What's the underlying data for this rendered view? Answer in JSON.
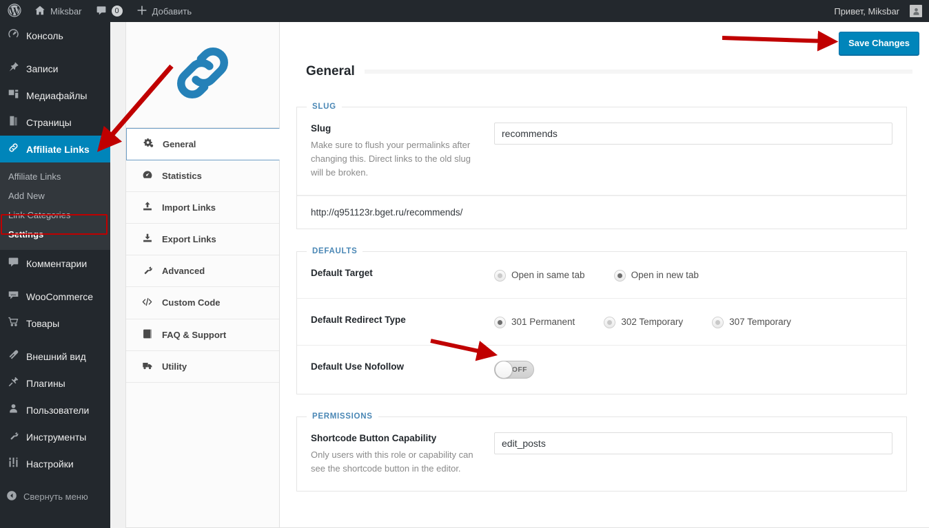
{
  "adminbar": {
    "logo_icon": "wordpress-icon",
    "site_name": "Miksbar",
    "site_icon": "home-icon",
    "comments_icon": "comment-icon",
    "comments_count": "0",
    "new_icon": "plus-icon",
    "new_label": "Добавить",
    "greeting": "Привет, Miksbar",
    "avatar_icon": "user-avatar-icon"
  },
  "adminmenu": {
    "items": [
      {
        "label": "Консоль",
        "icon": "dashboard-icon"
      },
      {
        "label": "Записи",
        "icon": "pin-icon"
      },
      {
        "label": "Медиафайлы",
        "icon": "media-icon"
      },
      {
        "label": "Страницы",
        "icon": "pages-icon"
      },
      {
        "label": "Affiliate Links",
        "icon": "link-icon",
        "current": true
      },
      {
        "label": "Комментарии",
        "icon": "comment-icon"
      },
      {
        "label": "WooCommerce",
        "icon": "woocommerce-icon"
      },
      {
        "label": "Товары",
        "icon": "cart-icon"
      },
      {
        "label": "Внешний вид",
        "icon": "appearance-icon"
      },
      {
        "label": "Плагины",
        "icon": "plugins-icon"
      },
      {
        "label": "Пользователи",
        "icon": "users-icon"
      },
      {
        "label": "Инструменты",
        "icon": "tools-icon"
      },
      {
        "label": "Настройки",
        "icon": "settings-icon"
      }
    ],
    "submenu": [
      {
        "label": "Affiliate Links"
      },
      {
        "label": "Add New"
      },
      {
        "label": "Link Categories"
      },
      {
        "label": "Settings",
        "current": true
      }
    ],
    "collapse_label": "Свернуть меню",
    "collapse_icon": "collapse-arrow-icon"
  },
  "plugin": {
    "logo_icon": "chain-link-logo",
    "tabs": [
      {
        "label": "General",
        "icon": "gears-icon",
        "active": true
      },
      {
        "label": "Statistics",
        "icon": "dashboard-icon",
        "active": false
      },
      {
        "label": "Import Links",
        "icon": "upload-icon",
        "active": false
      },
      {
        "label": "Export Links",
        "icon": "download-icon",
        "active": false
      },
      {
        "label": "Advanced",
        "icon": "wrench-icon",
        "active": false
      },
      {
        "label": "Custom Code",
        "icon": "code-icon",
        "active": false
      },
      {
        "label": "FAQ & Support",
        "icon": "book-icon",
        "active": false
      },
      {
        "label": "Utility",
        "icon": "truck-icon",
        "active": false
      }
    ],
    "save_label": "Save Changes",
    "page_title": "General",
    "sections": {
      "slug": {
        "legend": "SLUG",
        "field_label": "Slug",
        "field_desc": "Make sure to flush your permalinks after changing this. Direct links to the old slug will be broken.",
        "field_value": "recommends",
        "permalink_url": "http://q951123r.bget.ru/recommends/"
      },
      "defaults": {
        "legend": "DEFAULTS",
        "target_label": "Default Target",
        "target_options": [
          {
            "label": "Open in same tab",
            "checked": false
          },
          {
            "label": "Open in new tab",
            "checked": true
          }
        ],
        "redirect_label": "Default Redirect Type",
        "redirect_options": [
          {
            "label": "301 Permanent",
            "checked": true
          },
          {
            "label": "302 Temporary",
            "checked": false
          },
          {
            "label": "307 Temporary",
            "checked": false
          }
        ],
        "nofollow_label": "Default Use Nofollow",
        "nofollow_state": "OFF"
      },
      "permissions": {
        "legend": "PERMISSIONS",
        "field_label": "Shortcode Button Capability",
        "field_desc": "Only users with this role or capability can see the shortcode button in the editor.",
        "field_value": "edit_posts"
      }
    }
  },
  "colors": {
    "accent_blue": "#0085ba",
    "menu_dark": "#23282d",
    "submenu_dark": "#32373c",
    "legend_blue": "#4a87b5",
    "annotation_red": "#c00000",
    "logo_blue": "#2581b8"
  }
}
